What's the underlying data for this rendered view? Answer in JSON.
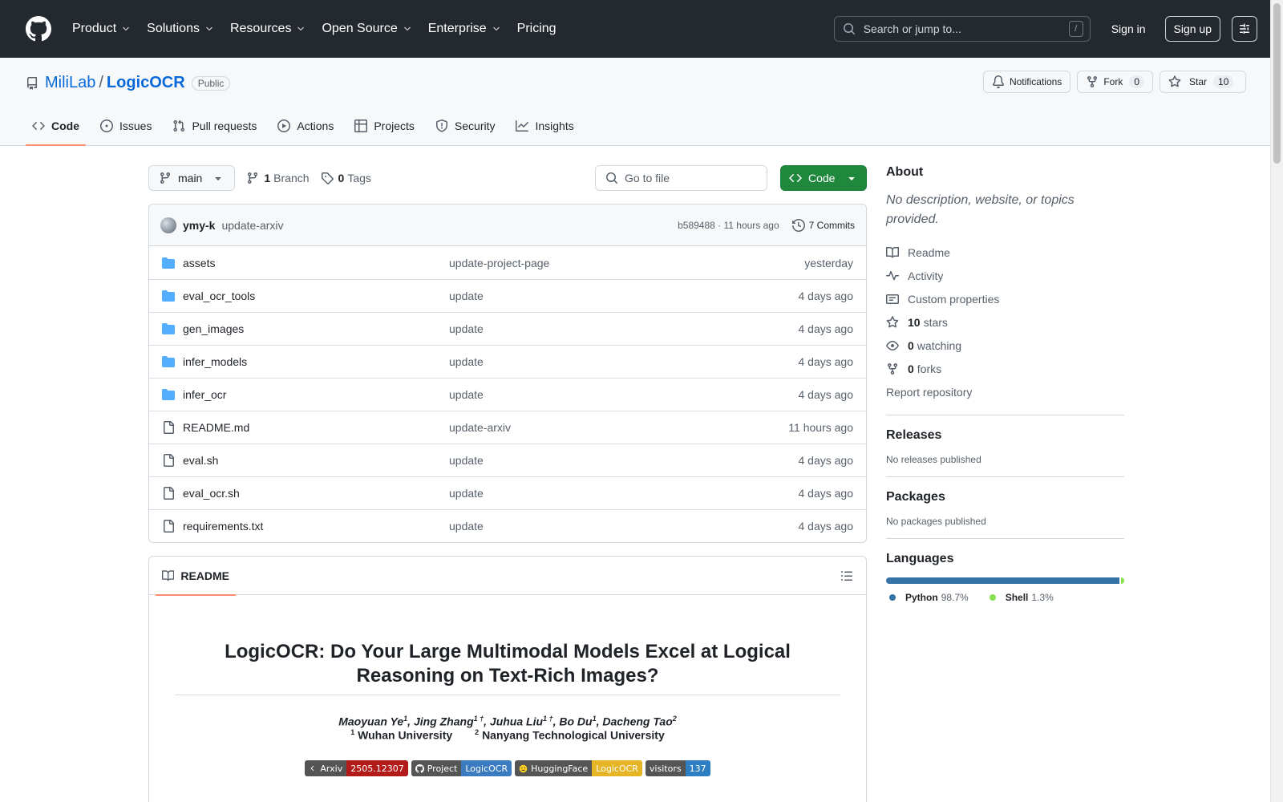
{
  "header": {
    "nav": [
      "Product",
      "Solutions",
      "Resources",
      "Open Source",
      "Enterprise",
      "Pricing"
    ],
    "search_placeholder": "Search or jump to...",
    "search_key": "/",
    "sign_in": "Sign in",
    "sign_up": "Sign up"
  },
  "repo": {
    "owner": "MiliLab",
    "separator": "/",
    "name": "LogicOCR",
    "visibility": "Public",
    "notifications": "Notifications",
    "fork_label": "Fork",
    "fork_count": "0",
    "star_label": "Star",
    "star_count": "10"
  },
  "tabs": [
    "Code",
    "Issues",
    "Pull requests",
    "Actions",
    "Projects",
    "Security",
    "Insights"
  ],
  "toolbar": {
    "branch": "main",
    "branch_count": "1",
    "branch_label": "Branch",
    "tag_count": "0",
    "tag_label": "Tags",
    "goto_placeholder": "Go to file",
    "code_button": "Code"
  },
  "commit": {
    "author": "ymy-k",
    "message": "update-arxiv",
    "meta": "b589488 · 11 hours ago",
    "commits": "7 Commits"
  },
  "files": [
    {
      "type": "folder",
      "name": "assets",
      "msg": "update-project-page",
      "date": "yesterday"
    },
    {
      "type": "folder",
      "name": "eval_ocr_tools",
      "msg": "update",
      "date": "4 days ago"
    },
    {
      "type": "folder",
      "name": "gen_images",
      "msg": "update",
      "date": "4 days ago"
    },
    {
      "type": "folder",
      "name": "infer_models",
      "msg": "update",
      "date": "4 days ago"
    },
    {
      "type": "folder",
      "name": "infer_ocr",
      "msg": "update",
      "date": "4 days ago"
    },
    {
      "type": "file",
      "name": "README.md",
      "msg": "update-arxiv",
      "date": "11 hours ago"
    },
    {
      "type": "file",
      "name": "eval.sh",
      "msg": "update",
      "date": "4 days ago"
    },
    {
      "type": "file",
      "name": "eval_ocr.sh",
      "msg": "update",
      "date": "4 days ago"
    },
    {
      "type": "file",
      "name": "requirements.txt",
      "msg": "update",
      "date": "4 days ago"
    }
  ],
  "readme": {
    "tab": "README",
    "title": "LogicOCR: Do Your Large Multimodal Models Excel at Logical Reasoning on Text-Rich Images?",
    "authors": [
      {
        "name": "Maoyuan Ye",
        "sup": "1",
        "sep": ", "
      },
      {
        "name": "Jing Zhang",
        "sup": "1 †",
        "sep": ", "
      },
      {
        "name": "Juhua Liu",
        "sup": "1 †",
        "sep": ", "
      },
      {
        "name": "Bo Du",
        "sup": "1",
        "sep": ", "
      },
      {
        "name": "Dacheng Tao",
        "sup": "2",
        "sep": ""
      }
    ],
    "affiliations": [
      {
        "sup": "1",
        "name": "Wuhan University"
      },
      {
        "sup": "2",
        "name": "Nanyang Technological University"
      }
    ],
    "badges": [
      {
        "left": "Arxiv",
        "right": "2505.12307",
        "color": "#b31b1b",
        "icon": "chevron-left-icon"
      },
      {
        "left": "Project",
        "right": "LogicOCR",
        "color": "#3b7bbf",
        "icon": "github-icon"
      },
      {
        "left": "HuggingFace",
        "right": "LogicOCR",
        "color": "#e5b526",
        "icon": "hugging-face-icon"
      },
      {
        "left": "visitors",
        "right": "137",
        "color": "#2d7fc1",
        "icon": ""
      }
    ]
  },
  "about": {
    "title": "About",
    "description": "No description, website, or topics provided.",
    "links": [
      {
        "icon": "book-icon",
        "bold": "",
        "text": "Readme"
      },
      {
        "icon": "pulse-icon",
        "bold": "",
        "text": "Activity"
      },
      {
        "icon": "note-icon",
        "bold": "",
        "text": "Custom properties"
      },
      {
        "icon": "star-icon",
        "bold": "10",
        "text": "stars"
      },
      {
        "icon": "eye-icon",
        "bold": "0",
        "text": "watching"
      },
      {
        "icon": "fork-icon",
        "bold": "0",
        "text": "forks"
      }
    ],
    "report": "Report repository"
  },
  "releases": {
    "title": "Releases",
    "text": "No releases published"
  },
  "packages": {
    "title": "Packages",
    "text": "No packages published"
  },
  "languages": {
    "title": "Languages",
    "items": [
      {
        "name": "Python",
        "pct": "98.7%",
        "value": 98.7,
        "color": "#3572A5"
      },
      {
        "name": "Shell",
        "pct": "1.3%",
        "value": 1.3,
        "color": "#89e051"
      }
    ]
  }
}
